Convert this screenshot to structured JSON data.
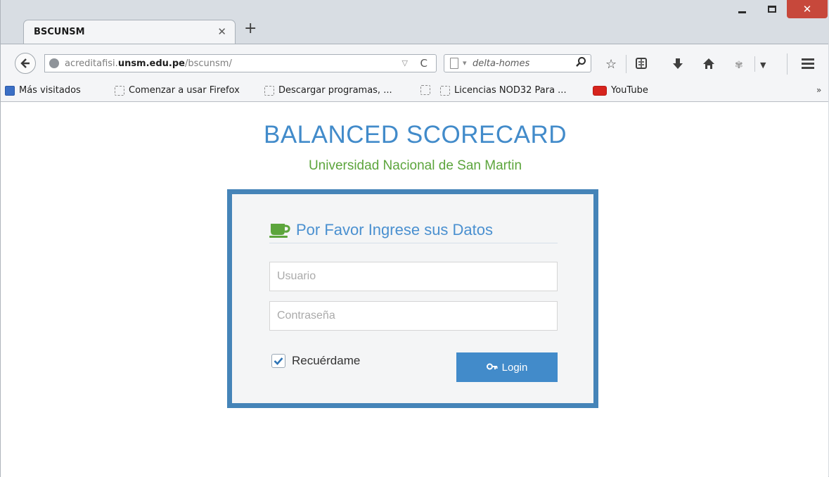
{
  "browser": {
    "tab_title": "BSCUNSM",
    "url_prefix": "acreditafisi.",
    "url_domain": "unsm.edu.pe",
    "url_path": "/bscunsm/",
    "search_placeholder": "delta-homes",
    "toolbar_icons": [
      "bookmark-star-icon",
      "reading-list-icon",
      "downloads-icon",
      "home-icon",
      "addon-icon",
      "menu-icon"
    ]
  },
  "bookmarks": [
    {
      "label": "Más visitados",
      "icon": "most-visited-icon"
    },
    {
      "label": "Comenzar a usar Firefox",
      "icon": "page-icon"
    },
    {
      "label": "Descargar programas, ...",
      "icon": "page-icon"
    },
    {
      "label": "",
      "icon": "page-icon"
    },
    {
      "label": "Licencias NOD32 Para ...",
      "icon": "page-icon"
    },
    {
      "label": "YouTube",
      "icon": "youtube-icon"
    }
  ],
  "page": {
    "title": "BALANCED SCORECARD",
    "subtitle": "Universidad Nacional de San Martin",
    "form_heading": "Por Favor Ingrese sus Datos",
    "username_placeholder": "Usuario",
    "password_placeholder": "Contraseña",
    "remember_label": "Recuérdame",
    "remember_checked": true,
    "login_label": "Login"
  },
  "colors": {
    "accent_blue": "#428bca",
    "box_border": "#4584b8",
    "subtitle_green": "#5ca53c",
    "close_red": "#c7483b"
  }
}
